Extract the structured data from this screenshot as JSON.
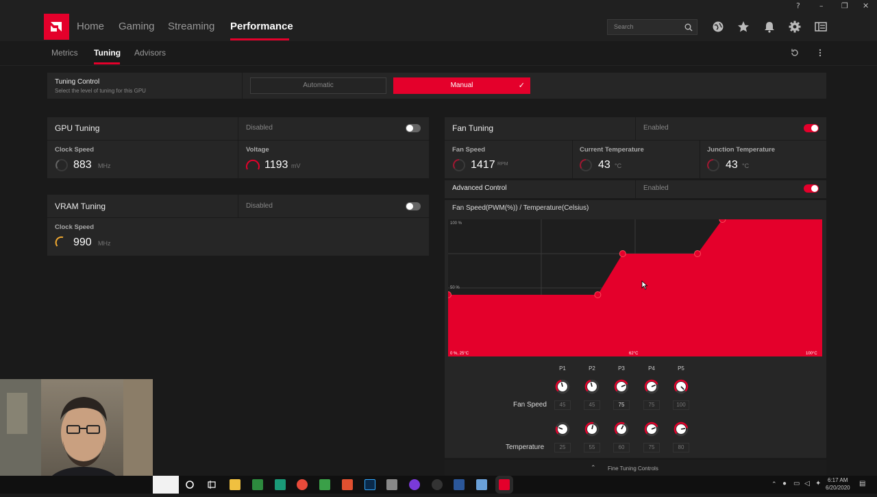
{
  "nav": {
    "items": [
      "Home",
      "Gaming",
      "Streaming",
      "Performance"
    ],
    "active": "Performance",
    "search_placeholder": "Search"
  },
  "subnav": {
    "items": [
      "Metrics",
      "Tuning",
      "Advisors"
    ],
    "active": "Tuning"
  },
  "tuning_control": {
    "title": "Tuning Control",
    "subtitle": "Select the level of tuning for this GPU",
    "automatic_label": "Automatic",
    "manual_label": "Manual",
    "selected": "Manual"
  },
  "gpu_tuning": {
    "title": "GPU Tuning",
    "status": "Disabled",
    "enabled": false,
    "clock_label": "Clock Speed",
    "clock_value": "883",
    "clock_unit": "MHz",
    "voltage_label": "Voltage",
    "voltage_value": "1193",
    "voltage_unit": "mV"
  },
  "vram_tuning": {
    "title": "VRAM Tuning",
    "status": "Disabled",
    "enabled": false,
    "clock_label": "Clock Speed",
    "clock_value": "990",
    "clock_unit": "MHz"
  },
  "fan_tuning": {
    "title": "Fan Tuning",
    "status": "Enabled",
    "enabled": true,
    "fan_speed_label": "Fan Speed",
    "fan_speed_value": "1417",
    "fan_speed_unit": "RPM",
    "current_temp_label": "Current Temperature",
    "current_temp_value": "43",
    "current_temp_unit": "°C",
    "junction_temp_label": "Junction Temperature",
    "junction_temp_value": "43",
    "junction_temp_unit": "°C",
    "advanced_label": "Advanced Control",
    "advanced_status": "Enabled",
    "curve_title": "Fan Speed(PWM(%)) / Temperature(Celsius)",
    "y_top_label": "100 %",
    "y_mid_label": "50 %",
    "x_min_label": "0 %, 25°C",
    "x_mid_label": "62°C",
    "x_max_label": "100°C",
    "fine_tuning_label": "Fine Tuning Controls"
  },
  "fan_points": {
    "labels": [
      "P1",
      "P2",
      "P3",
      "P4",
      "P5"
    ],
    "fan_speed_label": "Fan Speed",
    "fan_speed": [
      "45",
      "45",
      "75",
      "75",
      "100"
    ],
    "temperature_label": "Temperature",
    "temperature": [
      "25",
      "55",
      "60",
      "75",
      "80"
    ]
  },
  "chart_data": {
    "type": "area",
    "title": "Fan Speed(PWM(%)) / Temperature(Celsius)",
    "x": [
      25,
      55,
      60,
      75,
      80
    ],
    "y": [
      45,
      45,
      75,
      75,
      100
    ],
    "xlim": [
      25,
      100
    ],
    "ylim": [
      0,
      100
    ],
    "color": "#e4002b"
  },
  "taskbar": {
    "time": "6:17 AM",
    "date": "6/20/2020"
  },
  "colors": {
    "accent": "#e4002b",
    "gauge_vram": "#f0a830"
  }
}
